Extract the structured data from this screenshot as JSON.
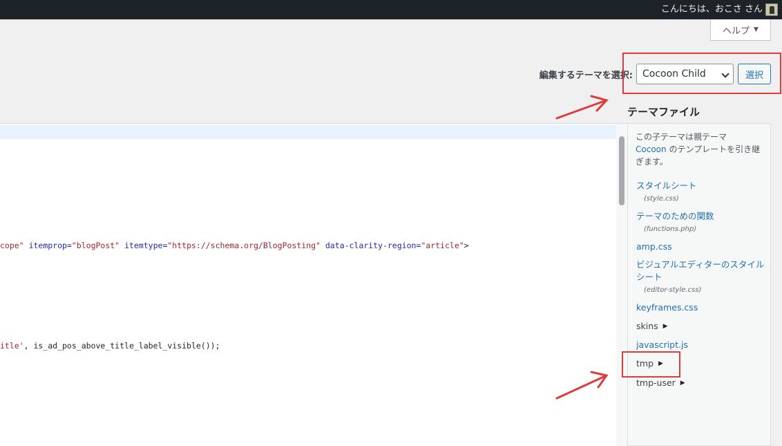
{
  "admin_bar": {
    "greeting": "こんにちは、おこさ さん"
  },
  "help": {
    "label": "ヘルプ",
    "arrow": "▼"
  },
  "theme_selector": {
    "label": "編集するテーマを選択:",
    "selected": "Cocoon Child",
    "submit_label": "選択"
  },
  "code": {
    "line_a": [
      {
        "t": "s",
        "v": "cope\""
      },
      {
        "t": "p",
        "v": " "
      },
      {
        "t": "a",
        "v": "itemprop="
      },
      {
        "t": "s",
        "v": "\"blogPost\""
      },
      {
        "t": "p",
        "v": " "
      },
      {
        "t": "a",
        "v": "itemtype="
      },
      {
        "t": "s",
        "v": "\"https://schema.org/BlogPosting\""
      },
      {
        "t": "p",
        "v": " "
      },
      {
        "t": "a",
        "v": "data-clarity-region="
      },
      {
        "t": "s",
        "v": "\"article\""
      },
      {
        "t": "p",
        "v": ">"
      }
    ],
    "line_b": [
      {
        "t": "s",
        "v": "itle'"
      },
      {
        "t": "p",
        "v": ", is_ad_pos_above_title_label_visible());"
      }
    ]
  },
  "theme_files": {
    "heading": "テーマファイル",
    "note_before": "この子テーマは親テーマ",
    "parent_theme": "Cocoon",
    "note_after": "のテンプレートを引き継ぎます。",
    "stylesheet": {
      "label": "スタイルシート",
      "file": "(style.css)"
    },
    "functions": {
      "label": "テーマのための関数",
      "file": "(functions.php)"
    },
    "amp": "amp.css",
    "editor_style": {
      "label": "ビジュアルエディターのスタイルシート",
      "file": "(editor-style.css)"
    },
    "keyframes": "keyframes.css",
    "skins": "skins",
    "javascript": "javascript.js",
    "tmp": "tmp",
    "tmp_user": "tmp-user",
    "folder_arrow": "▶"
  },
  "annotation_color": "#e03a3a"
}
